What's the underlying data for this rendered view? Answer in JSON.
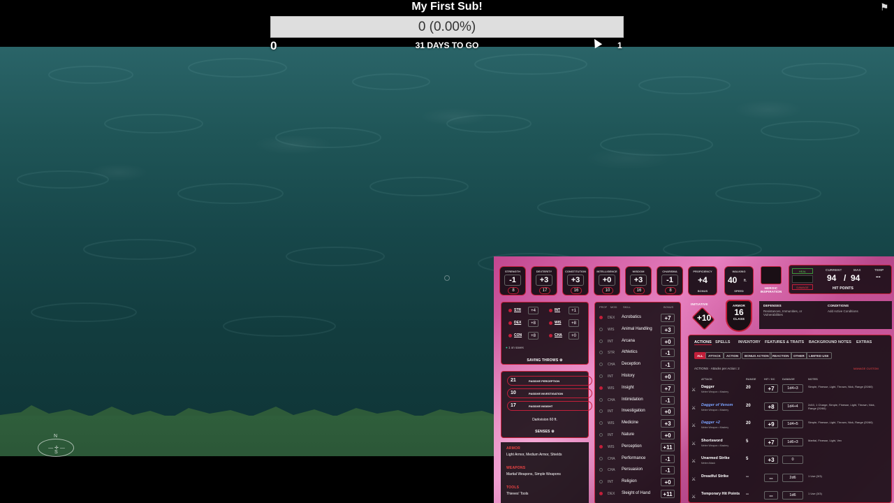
{
  "goal": {
    "title": "My First Sub!",
    "value_text": "0 (0.00%)",
    "progress": 0,
    "min": "0",
    "max": "1",
    "days_left": "31 DAYS TO GO"
  },
  "colors": {
    "goal_bar": "#dedede",
    "accent": "#c21f3a",
    "water": "#17474a",
    "sheet_pink": "#e680bf"
  },
  "compass": {
    "n": "N",
    "s": "S"
  },
  "sheet": {
    "abilities": [
      {
        "name": "STRENGTH",
        "mod": "-1",
        "score": "8"
      },
      {
        "name": "DEXTERITY",
        "mod": "+3",
        "score": "17"
      },
      {
        "name": "CONSTITUTION",
        "mod": "+3",
        "score": "16"
      },
      {
        "name": "INTELLIGENCE",
        "mod": "+0",
        "score": "10"
      },
      {
        "name": "WISDOM",
        "mod": "+3",
        "score": "16"
      },
      {
        "name": "CHARISMA",
        "mod": "-1",
        "score": "8"
      }
    ],
    "proficiency": {
      "label": "PROFICIENCY",
      "value": "+4",
      "sub": "BONUS"
    },
    "speed": {
      "label": "WALKING",
      "value": "40",
      "unit": "ft.",
      "sub": "SPEED"
    },
    "inspiration": {
      "label": "HEROIC INSPIRATION"
    },
    "hp": {
      "heal": "HEAL",
      "damage": "DAMAGE",
      "current_label": "CURRENT",
      "max_label": "MAX",
      "temp_label": "TEMP",
      "current": "94",
      "sep": "/",
      "max": "94",
      "temp": "--",
      "title": "HIT POINTS"
    },
    "saves": [
      {
        "name": "STR",
        "value": "+4"
      },
      {
        "name": "INT",
        "value": "+1"
      },
      {
        "name": "DEX",
        "value": "+8"
      },
      {
        "name": "WIS",
        "value": "+8"
      },
      {
        "name": "CON",
        "value": "+8"
      },
      {
        "name": "CHA",
        "value": "+0"
      }
    ],
    "saves_note": "1 on saves",
    "saves_title": "SAVING THROWS",
    "passives": [
      {
        "value": "21",
        "label": "PASSIVE PERCEPTION"
      },
      {
        "value": "10",
        "label": "PASSIVE INVESTIGATION"
      },
      {
        "value": "17",
        "label": "PASSIVE INSIGHT"
      }
    ],
    "darkvision": "Darkvision 60 ft.",
    "senses_title": "SENSES",
    "profs": [
      {
        "title": "ARMOR",
        "text": "Light Armor, Medium Armor, Shields"
      },
      {
        "title": "WEAPONS",
        "text": "Martial Weapons, Simple Weapons"
      },
      {
        "title": "TOOLS",
        "text": "Thieves' Tools"
      }
    ],
    "skills_header": {
      "prof": "PROF",
      "mod": "MOD",
      "skill": "SKILL",
      "bonus": "BONUS"
    },
    "skills": [
      {
        "mod": "DEX",
        "name": "Acrobatics",
        "value": "+7",
        "prof": true
      },
      {
        "mod": "WIS",
        "name": "Animal Handling",
        "value": "+3",
        "prof": false
      },
      {
        "mod": "INT",
        "name": "Arcana",
        "value": "+0",
        "prof": false
      },
      {
        "mod": "STR",
        "name": "Athletics",
        "value": "-1",
        "prof": false
      },
      {
        "mod": "CHA",
        "name": "Deception",
        "value": "-1",
        "prof": false
      },
      {
        "mod": "INT",
        "name": "History",
        "value": "+0",
        "prof": false
      },
      {
        "mod": "WIS",
        "name": "Insight",
        "value": "+7",
        "prof": true
      },
      {
        "mod": "CHA",
        "name": "Intimidation",
        "value": "-1",
        "prof": false
      },
      {
        "mod": "INT",
        "name": "Investigation",
        "value": "+0",
        "prof": false
      },
      {
        "mod": "WIS",
        "name": "Medicine",
        "value": "+3",
        "prof": false
      },
      {
        "mod": "INT",
        "name": "Nature",
        "value": "+0",
        "prof": false
      },
      {
        "mod": "WIS",
        "name": "Perception",
        "value": "+11",
        "prof": true
      },
      {
        "mod": "CHA",
        "name": "Performance",
        "value": "-1",
        "prof": false
      },
      {
        "mod": "CHA",
        "name": "Persuasion",
        "value": "-1",
        "prof": false
      },
      {
        "mod": "INT",
        "name": "Religion",
        "value": "+0",
        "prof": false
      },
      {
        "mod": "DEX",
        "name": "Sleight of Hand",
        "value": "+11",
        "prof": true
      }
    ],
    "initiative": {
      "label": "INITIATIVE",
      "value": "+10"
    },
    "armor": {
      "label": "ARMOR",
      "value": "16",
      "sub": "CLASS"
    },
    "defenses": {
      "title": "DEFENSES",
      "text": "Resistances, Immunities, or Vulnerabilities"
    },
    "conditions": {
      "title": "CONDITIONS",
      "text": "Add Active Conditions"
    },
    "tabs": [
      "ACTIONS",
      "SPELLS",
      "INVENTORY",
      "FEATURES & TRAITS",
      "BACKGROUND",
      "NOTES",
      "EXTRAS"
    ],
    "subtabs": [
      "ALL",
      "ATTACK",
      "ACTION",
      "BONUS ACTION",
      "REACTION",
      "OTHER",
      "LIMITED USE"
    ],
    "actions_note": "ACTIONS · Attacks per Action: 2",
    "manage": "MANAGE CUSTOM",
    "attack_header": {
      "attack": "ATTACK",
      "range": "RANGE",
      "hit": "HIT / DC",
      "damage": "DAMAGE",
      "notes": "NOTES"
    },
    "attacks": [
      {
        "name": "Dagger",
        "sub": "Melee Weapon • Mastery",
        "range": "20",
        "hit": "+7",
        "damage": "1d4+3",
        "notes": "Simple, Finesse, Light, Thrown, Nick, Range (20/60)",
        "magic": false
      },
      {
        "name": "Dagger of Venom",
        "sub": "Melee Weapon • Mastery",
        "range": "20",
        "hit": "+8",
        "damage": "1d4+4",
        "notes": "2d10, 1 Charge, Simple, Finesse, Light, Thrown, Nick, Range (20/60)",
        "magic": true
      },
      {
        "name": "Dagger +2",
        "sub": "Melee Weapon • Mastery",
        "range": "20",
        "hit": "+9",
        "damage": "1d4+5",
        "notes": "Simple, Finesse, Light, Thrown, Nick, Range (20/60)",
        "magic": true
      },
      {
        "name": "Shortsword",
        "sub": "Melee Weapon • Mastery",
        "range": "5",
        "hit": "+7",
        "damage": "1d6+3",
        "notes": "Martial, Finesse, Light, Vex",
        "magic": false
      },
      {
        "name": "Unarmed Strike",
        "sub": "Melee Attack",
        "range": "5",
        "hit": "+3",
        "damage": "0",
        "notes": "",
        "magic": false
      },
      {
        "name": "Dreadful Strike",
        "sub": "",
        "range": "--",
        "hit": "--",
        "damage": "2d6",
        "notes": "1 Use (3/3)",
        "magic": false
      },
      {
        "name": "Temporary Hit Points",
        "sub": "",
        "range": "--",
        "hit": "--",
        "damage": "1d6",
        "notes": "1 Use (3/3)",
        "magic": false
      }
    ]
  }
}
